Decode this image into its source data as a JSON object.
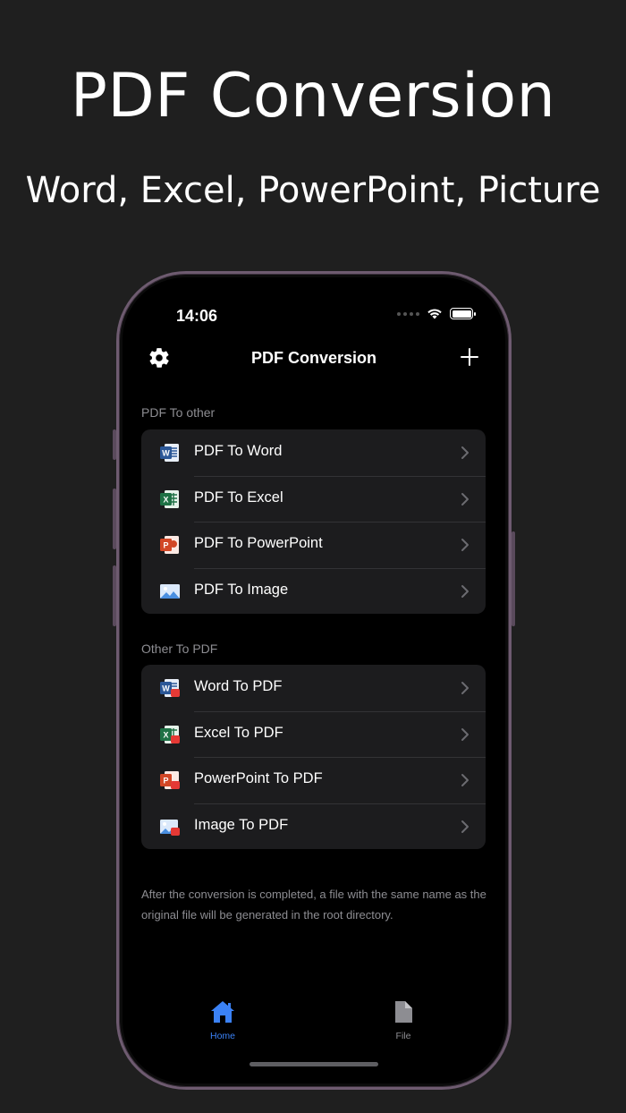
{
  "promo": {
    "title": "PDF Conversion",
    "subtitle": "Word, Excel, PowerPoint, Picture"
  },
  "status_bar": {
    "time": "14:06"
  },
  "nav": {
    "title": "PDF Conversion",
    "left_icon": "gear-icon",
    "right_icon": "plus-icon"
  },
  "sections": [
    {
      "header": "PDF To other",
      "items": [
        {
          "label": "PDF To Word",
          "icon": "word-icon"
        },
        {
          "label": "PDF To Excel",
          "icon": "excel-icon"
        },
        {
          "label": "PDF To PowerPoint",
          "icon": "powerpoint-icon"
        },
        {
          "label": "PDF To Image",
          "icon": "image-icon"
        }
      ]
    },
    {
      "header": "Other To PDF",
      "items": [
        {
          "label": "Word To PDF",
          "icon": "word-to-pdf-icon"
        },
        {
          "label": "Excel To PDF",
          "icon": "excel-to-pdf-icon"
        },
        {
          "label": "PowerPoint To PDF",
          "icon": "powerpoint-to-pdf-icon"
        },
        {
          "label": "Image To PDF",
          "icon": "image-to-pdf-icon"
        }
      ]
    }
  ],
  "footer_note": "After the conversion is completed, a file with the same name as the original file will be generated in the root directory.",
  "tabs": [
    {
      "label": "Home",
      "icon": "home-icon",
      "active": true
    },
    {
      "label": "File",
      "icon": "file-icon",
      "active": false
    }
  ],
  "colors": {
    "background": "#1f1f1f",
    "screen": "#000000",
    "group_bg": "#1c1c1e",
    "secondary_text": "#8d8d92",
    "accent": "#3b82f6",
    "word": "#2b5797",
    "excel": "#1e7145",
    "powerpoint": "#d24726",
    "pdf_badge": "#e53935"
  }
}
